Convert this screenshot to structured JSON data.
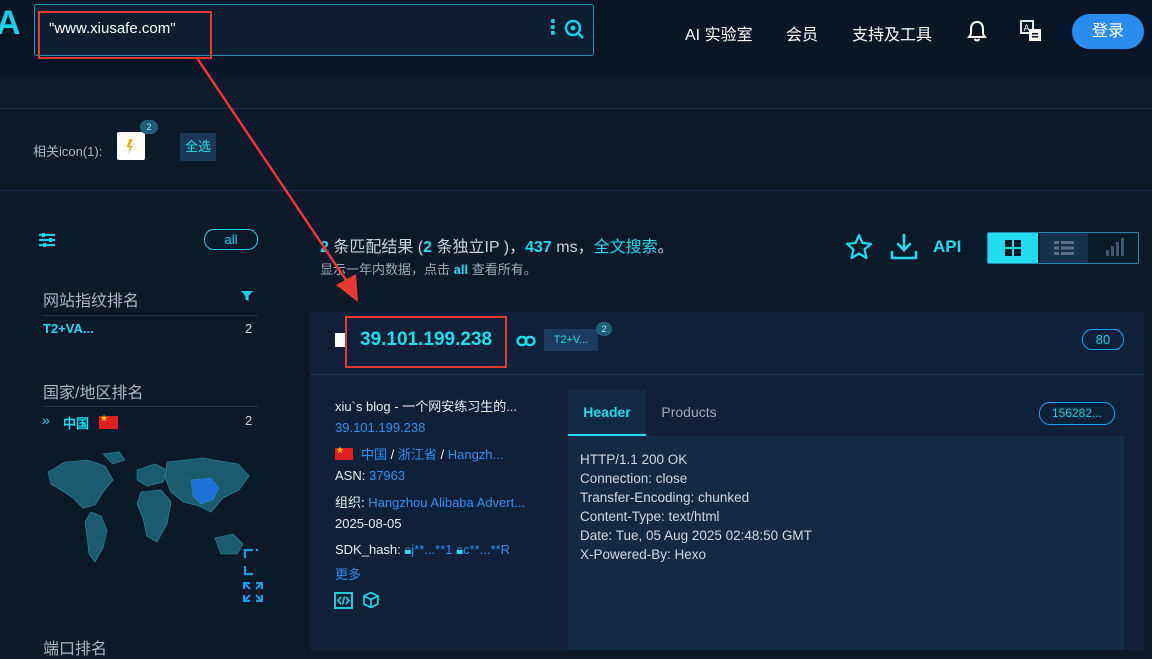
{
  "search": {
    "value": "\"www.xiusafe.com\""
  },
  "nav": {
    "logo": "A",
    "ai_lab": "AI 实验室",
    "member": "会员",
    "tools": "支持及工具",
    "login": "登录"
  },
  "icons_row": {
    "label": "相关icon(1):",
    "badge": "2",
    "select_all": "全选"
  },
  "sidebar": {
    "all": "all",
    "fingerprint_title": "网站指纹排名",
    "fingerprint_items": [
      {
        "name": "T2+VA...",
        "count": "2"
      }
    ],
    "country_title": "国家/地区排名",
    "country_items": [
      {
        "name": "中国",
        "count": "2"
      }
    ],
    "port_title": "端口排名"
  },
  "results": {
    "count": "2",
    "text1": " 条匹配结果 (",
    "ip_count": "2",
    "text2": " 条独立IP )，",
    "ms": "437",
    "text3": " ms，",
    "fulltext": "全文搜索",
    "text4": "。",
    "sub1": "显示一年内数据，点击 ",
    "sub_all": "all",
    "sub2": " 查看所有。",
    "api": "API"
  },
  "card": {
    "ip": "39.101.199.238",
    "tag": "T2+V...",
    "tag_badge": "2",
    "port": "80",
    "title": "xiu`s blog - 一个网安练习生的...",
    "ip_link": "39.101.199.238",
    "country": "中国",
    "sep1": " / ",
    "province": "浙江省",
    "sep2": " / ",
    "city": "Hangzh...",
    "asn_label": "ASN: ",
    "asn": "37963",
    "org_label": "组织: ",
    "org": "Hangzhou Alibaba Advert...",
    "date": "2025-08-05",
    "sdk_label": "SDK_hash: ",
    "sdk1": "j**...**1",
    "sdk2": "c**...**R",
    "more": "更多"
  },
  "header_panel": {
    "tab_header": "Header",
    "tab_products": "Products",
    "cert": "156282...",
    "lines": [
      "HTTP/1.1 200 OK",
      "Connection: close",
      "Transfer-Encoding: chunked",
      "Content-Type: text/html",
      "Date: Tue, 05 Aug 2025 02:48:50 GMT",
      "X-Powered-By: Hexo"
    ]
  },
  "colors": {
    "accent": "#22dcec",
    "link": "#2f8ff0",
    "highlight": "#e53935",
    "background": "#0b1a2b"
  }
}
